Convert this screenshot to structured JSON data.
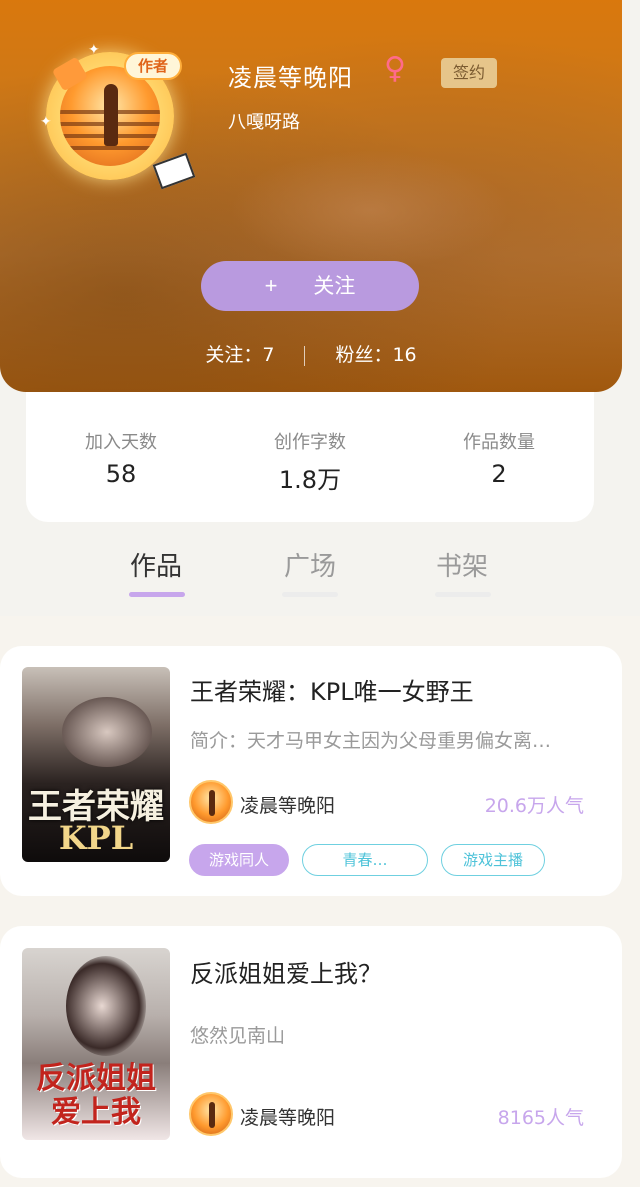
{
  "profile": {
    "avatar_badge": "作者",
    "username": "凌晨等晚阳",
    "gender_icon": "female-icon",
    "gender_symbol": "♀",
    "sign_badge": "签约",
    "subtitle": "八嘎呀路",
    "follow_plus": "+",
    "follow_label": "关注",
    "following_label": "关注：7",
    "fans_label": "粉丝：16"
  },
  "info": {
    "join_days_label": "加入天数",
    "join_days_value": "58",
    "words_label": "创作字数",
    "words_value": "1.8万",
    "works_label": "作品数量",
    "works_value": "2"
  },
  "tabs": [
    {
      "label": "作品",
      "active": true
    },
    {
      "label": "广场",
      "active": false
    },
    {
      "label": "书架",
      "active": false
    }
  ],
  "books": [
    {
      "title": "王者荣耀：KPL唯一女野王",
      "desc": "简介：天才马甲女主因为父母重男偏女离…",
      "author": "凌晨等晚阳",
      "popularity": "20.6万人气",
      "cover_title": "王者荣耀",
      "cover_sub": "KPL",
      "tags": [
        "游戏同人",
        "青春…",
        "游戏主播"
      ]
    },
    {
      "title": "反派姐姐爱上我？",
      "desc": "悠然见南山",
      "author": "凌晨等晚阳",
      "popularity": "8165人气",
      "cover_title": "反派姐姐爱上我"
    }
  ],
  "colors": {
    "accent": "#c7a6ec",
    "follow_button": "#b99adf",
    "header_orange": "#d9780d",
    "tag_outline": "#4fc3d9",
    "gender_pink": "#ff6b8a"
  }
}
